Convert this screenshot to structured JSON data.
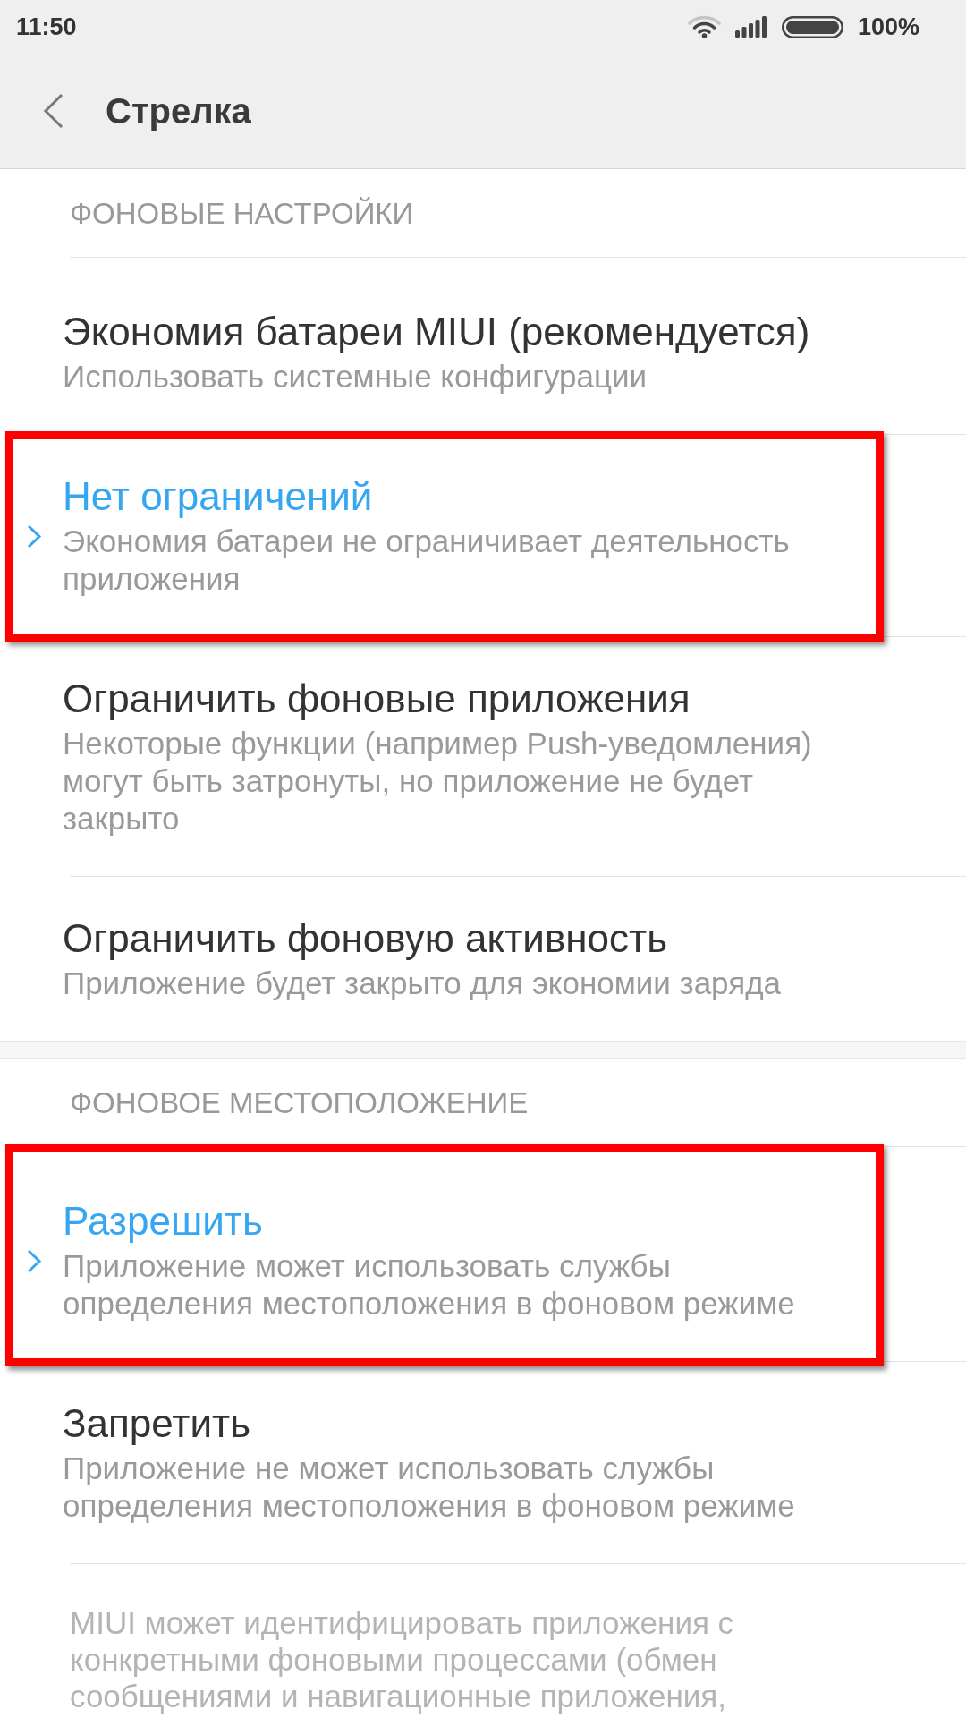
{
  "status_bar": {
    "time": "11:50",
    "battery": "100%"
  },
  "header": {
    "title": "Стрелка"
  },
  "sections": [
    {
      "title": "ФОНОВЫЕ НАСТРОЙКИ",
      "options": [
        {
          "title": "Экономия батареи MIUI (рекомендуется)",
          "description": "Использовать системные конфигурации",
          "selected": false,
          "highlighted": false
        },
        {
          "title": "Нет ограничений",
          "description": "Экономия батареи не ограничивает деятельность приложения",
          "selected": true,
          "highlighted": true
        },
        {
          "title": "Ограничить фоновые приложения",
          "description": "Некоторые функции (например Push-уведомления) могут быть затронуты, но приложение не будет закрыто",
          "selected": false,
          "highlighted": false
        },
        {
          "title": "Ограничить фоновую активность",
          "description": "Приложение будет закрыто для экономии заряда",
          "selected": false,
          "highlighted": false
        }
      ]
    },
    {
      "title": "ФОНОВОЕ МЕСТОПОЛОЖЕНИЕ",
      "options": [
        {
          "title": "Разрешить",
          "description": "Приложение может использовать службы определения местоположения в фоновом режиме",
          "selected": true,
          "highlighted": true
        },
        {
          "title": "Запретить",
          "description": "Приложение не может использовать службы определения местоположения в фоновом режиме",
          "selected": false,
          "highlighted": false
        }
      ]
    }
  ],
  "footer_note": "MIUI может идентифицировать приложения с конкретными фоновыми процессами (обмен сообщениями и навигационные приложения,"
}
